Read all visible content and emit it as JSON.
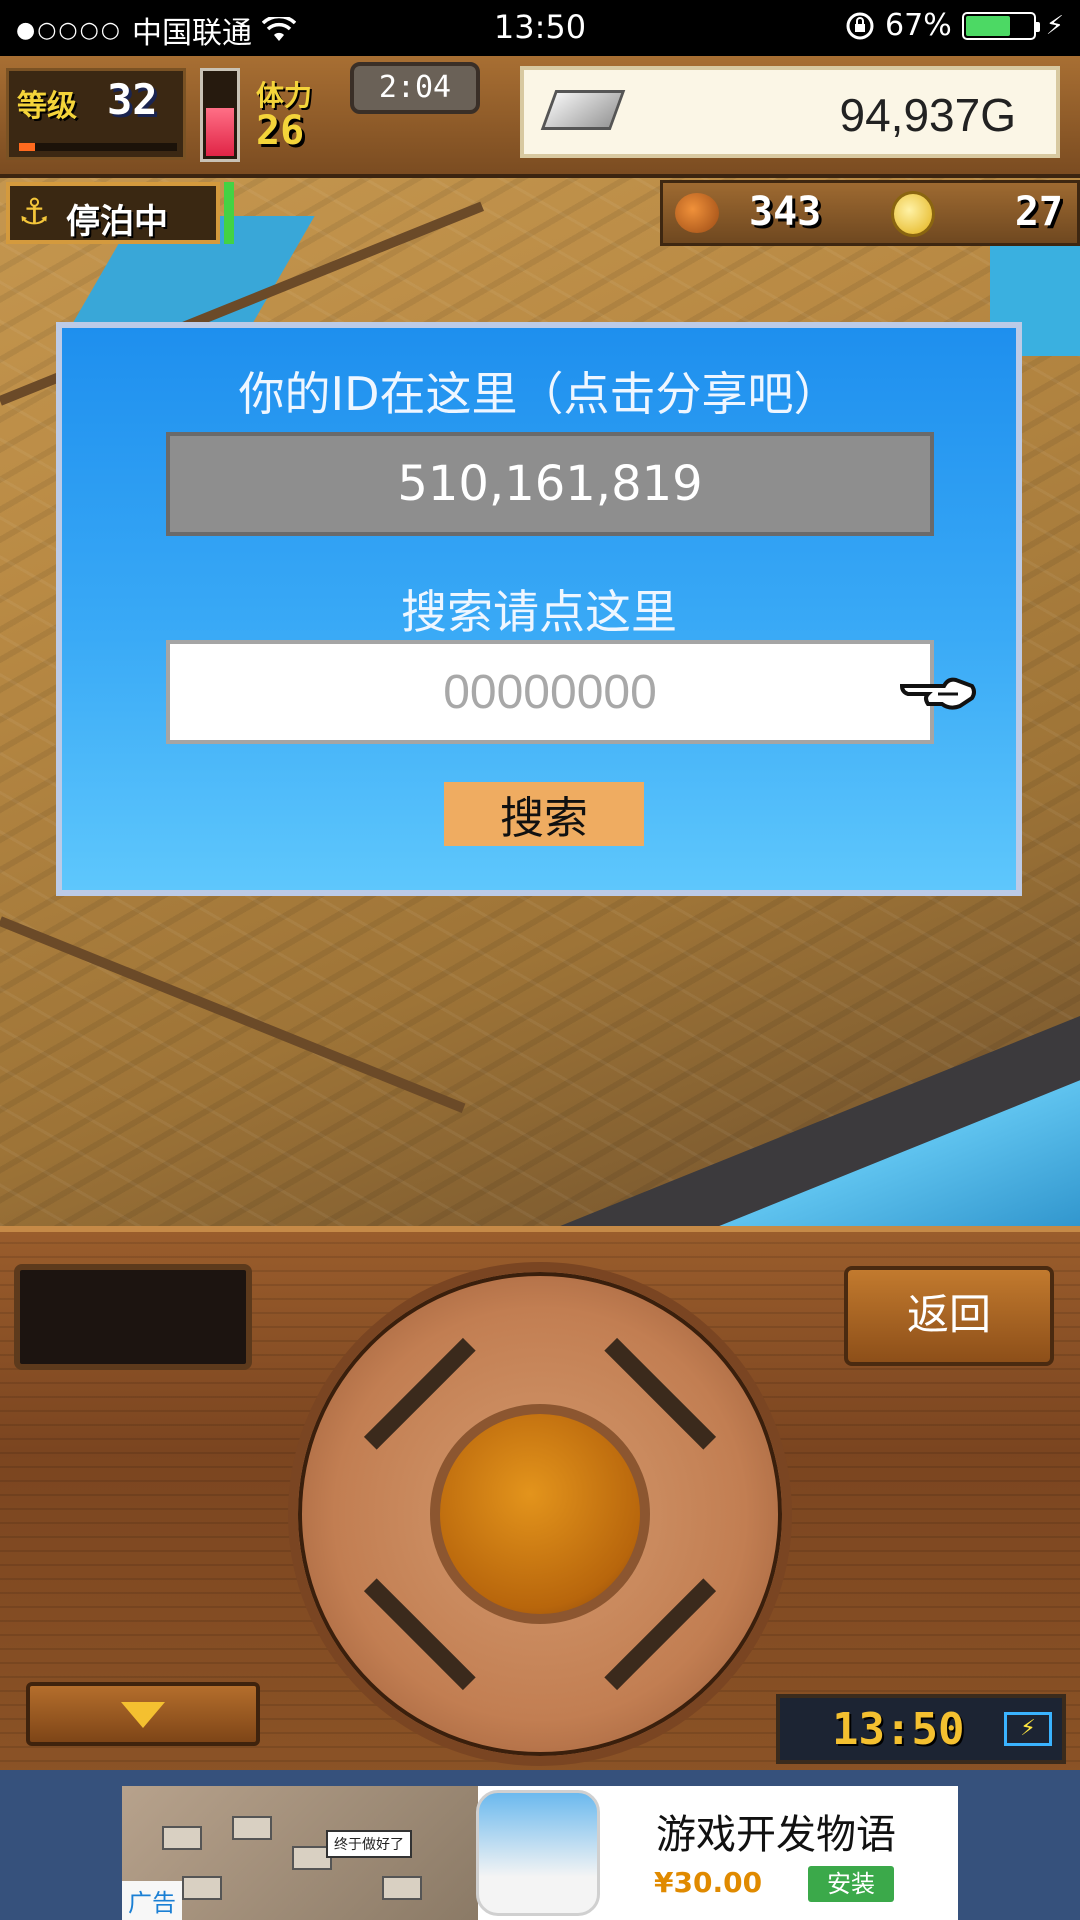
{
  "status_bar": {
    "signal_dots": "●○○○○",
    "carrier": "中国联通",
    "wifi_icon": "wifi-icon",
    "time": "13:50",
    "battery_percent": "67%",
    "battery_level": 0.67
  },
  "hud": {
    "level_label": "等级",
    "level_value": "32",
    "level_progress": 0.1,
    "stamina_label": "体力",
    "stamina_value": "26",
    "stamina_fill": 0.55,
    "timer": "2:04",
    "gold": "94,937G",
    "status_label": "停泊中",
    "meat": "343",
    "medals": "27"
  },
  "dialog": {
    "title": "你的ID在这里（点击分享吧）",
    "player_id": "510,161,819",
    "search_label": "搜索请点这里",
    "search_placeholder": "00000000",
    "search_value": "",
    "search_button": "搜索"
  },
  "controls": {
    "back_button": "返回",
    "clock": "13:50"
  },
  "ad": {
    "tag": "广告",
    "bubble": "终于做好了",
    "title": "游戏开发物语",
    "price": "¥30.00",
    "install": "安装"
  },
  "colors": {
    "dialog_blue": "#1e8fee",
    "gold_yellow": "#f4c030",
    "install_green": "#3ba94a",
    "search_button": "#efac61"
  }
}
